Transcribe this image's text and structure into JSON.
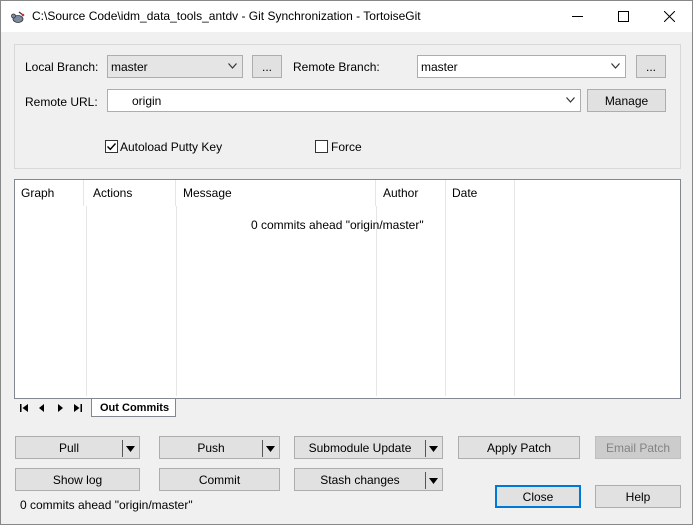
{
  "window": {
    "title": "C:\\Source Code\\idm_data_tools_antdv - Git Synchronization - TortoiseGit"
  },
  "options": {
    "local_branch_label": "Local Branch:",
    "local_branch_value": "master",
    "local_branch_browse": "...",
    "remote_branch_label": "Remote Branch:",
    "remote_branch_value": "master",
    "remote_branch_browse": "...",
    "remote_url_label": "Remote URL:",
    "remote_url_value": "origin",
    "manage_label": "Manage",
    "autoload_label": "Autoload Putty Key",
    "autoload_checked": true,
    "force_label": "Force",
    "force_checked": false
  },
  "log_list": {
    "columns": [
      "Graph",
      "Actions",
      "Message",
      "Author",
      "Date"
    ],
    "empty_message": "0 commits ahead \"origin/master\""
  },
  "tabs": {
    "active": "Out Commits"
  },
  "buttons": {
    "pull": "Pull",
    "push": "Push",
    "submodule_update": "Submodule Update",
    "apply_patch": "Apply Patch",
    "email_patch": "Email Patch",
    "show_log": "Show log",
    "commit": "Commit",
    "stash_changes": "Stash changes",
    "close": "Close",
    "help": "Help"
  },
  "status": {
    "text": "0 commits ahead \"origin/master\""
  },
  "colors": {
    "default_button_border": "#0078d7",
    "disabled_text": "#838383"
  }
}
